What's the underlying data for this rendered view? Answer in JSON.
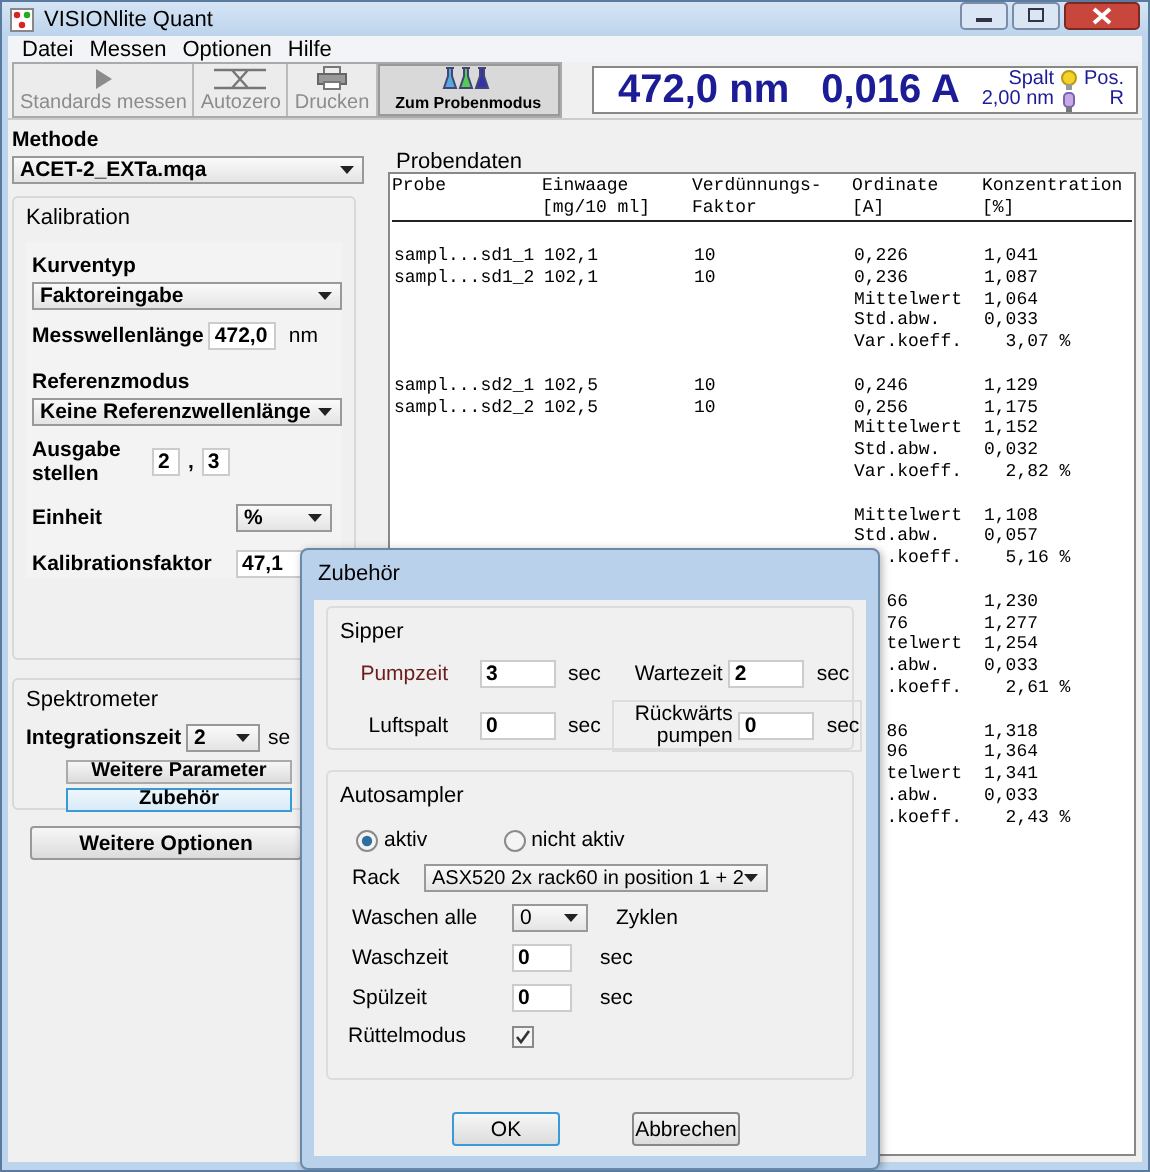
{
  "window": {
    "title": "VISIONlite Quant"
  },
  "menu": [
    "Datei",
    "Messen",
    "Optionen",
    "Hilfe"
  ],
  "toolbar": [
    {
      "label": "Standards messen",
      "disabled": true
    },
    {
      "label": "Autozero",
      "disabled": true
    },
    {
      "label": "Drucken",
      "disabled": true
    },
    {
      "label": "Zum Probenmodus",
      "disabled": false
    }
  ],
  "readout": {
    "wavelength": "472,0 nm",
    "absorbance": "0,016 A",
    "slit_label": "Spalt",
    "slit_value": "2,00 nm",
    "pos_label": "Pos.",
    "pos_value": "R"
  },
  "methode": {
    "label": "Methode",
    "value": "ACET-2_EXTa.mqa"
  },
  "kalibration": {
    "title": "Kalibration",
    "kurventyp_label": "Kurventyp",
    "kurventyp": "Faktoreingabe",
    "mess_label": "Messwellenlänge",
    "mess_value": "472,0",
    "mess_unit": "nm",
    "ref_label": "Referenzmodus",
    "ref_value": "Keine Referenzwellenlänge",
    "ausgabe_label": "Ausgabe stellen",
    "ausgabe_a": "2",
    "ausgabe_sep": ",",
    "ausgabe_b": "3",
    "einheit_label": "Einheit",
    "einheit": "%",
    "faktor_label": "Kalibrationsfaktor",
    "faktor": "47,1"
  },
  "spektrometer": {
    "title": "Spektrometer",
    "int_label": "Integrationszeit",
    "int_value": "2",
    "int_unit": "se",
    "buttons": [
      {
        "label": "Weitere Parameter",
        "focused": false
      },
      {
        "label": "Zubehör",
        "focused": true
      }
    ]
  },
  "weitere_optionen": "Weitere Optionen",
  "probendaten": {
    "title": "Probendaten",
    "columns": [
      {
        "line1": "Probe"
      },
      {
        "line1": "Einwaage",
        "line2": "[mg/10 ml]"
      },
      {
        "line1": "Verdünnungs-",
        "line2": "Faktor"
      },
      {
        "line1": "Ordinate",
        "line2": "[A]"
      },
      {
        "line1": "Konzentration",
        "line2": "[%]"
      }
    ],
    "groups": [
      {
        "rows": [
          {
            "kind": "full",
            "cells": [
              "sampl...sd1_1",
              "102,1",
              "10",
              "0,226",
              "1,041"
            ]
          },
          {
            "kind": "full",
            "cells": [
              "sampl...sd1_2",
              "102,1",
              "10",
              "0,236",
              "1,087"
            ]
          },
          {
            "kind": "full",
            "cells": [
              "",
              "",
              "",
              "Mittelwert",
              "1,064"
            ]
          },
          {
            "kind": "full",
            "cells": [
              "",
              "",
              "",
              "Std.abw.",
              "0,033"
            ]
          },
          {
            "kind": "full",
            "cells": [
              "",
              "",
              "",
              "Var.koeff.",
              "  3,07 %"
            ]
          }
        ]
      },
      {
        "rows": [
          {
            "kind": "full",
            "cells": [
              "sampl...sd2_1",
              "102,5",
              "10",
              "0,246",
              "1,129"
            ]
          },
          {
            "kind": "full",
            "cells": [
              "sampl...sd2_2",
              "102,5",
              "10",
              "0,256",
              "1,175"
            ]
          },
          {
            "kind": "full",
            "cells": [
              "",
              "",
              "",
              "Mittelwert",
              "1,152"
            ]
          },
          {
            "kind": "full",
            "cells": [
              "",
              "",
              "",
              "Std.abw.",
              "0,032"
            ]
          },
          {
            "kind": "full",
            "cells": [
              "",
              "",
              "",
              "Var.koeff.",
              "  2,82 %"
            ]
          }
        ]
      },
      {
        "rows": [
          {
            "kind": "full",
            "cells": [
              "",
              "",
              "",
              "Mittelwert",
              "1,108"
            ]
          },
          {
            "kind": "full",
            "cells": [
              "",
              "",
              "",
              "Std.abw.",
              "0,057"
            ]
          },
          {
            "kind": "partial",
            "cells": [
              "",
              "",
              "",
              ".koeff.",
              "  5,16 %"
            ]
          }
        ]
      },
      {
        "rows": [
          {
            "kind": "partial",
            "cells": [
              "",
              "",
              "",
              "66",
              "1,230"
            ]
          },
          {
            "kind": "partial",
            "cells": [
              "",
              "",
              "",
              "76",
              "1,277"
            ]
          },
          {
            "kind": "partial",
            "cells": [
              "",
              "",
              "",
              "telwert",
              "1,254"
            ]
          },
          {
            "kind": "partial",
            "cells": [
              "",
              "",
              "",
              ".abw.",
              "0,033"
            ]
          },
          {
            "kind": "partial",
            "cells": [
              "",
              "",
              "",
              ".koeff.",
              "  2,61 %"
            ]
          }
        ]
      },
      {
        "rows": [
          {
            "kind": "partial",
            "cells": [
              "",
              "",
              "",
              "86",
              "1,318"
            ]
          },
          {
            "kind": "partial",
            "cells": [
              "",
              "",
              "",
              "96",
              "1,364"
            ]
          },
          {
            "kind": "partial",
            "cells": [
              "",
              "",
              "",
              "telwert",
              "1,341"
            ]
          },
          {
            "kind": "partial",
            "cells": [
              "",
              "",
              "",
              ".abw.",
              "0,033"
            ]
          },
          {
            "kind": "partial",
            "cells": [
              "",
              "",
              "",
              ".koeff.",
              "  2,43 %"
            ]
          }
        ]
      }
    ]
  },
  "dialog": {
    "title": "Zubehör",
    "sipper": {
      "title": "Sipper",
      "fields": [
        {
          "kind": "plain",
          "label": "Pumpzeit",
          "value": "3",
          "unit": "sec",
          "color": "#6b1c1c"
        },
        {
          "kind": "plain",
          "label": "Wartezeit",
          "value": "2",
          "unit": "sec",
          "color": "#000000"
        },
        {
          "kind": "plain",
          "label": "Luftspalt",
          "value": "0",
          "unit": "sec",
          "color": "#000000"
        },
        {
          "kind": "boxed",
          "label": "Rückwärts pumpen",
          "value": "0",
          "unit": "sec",
          "color": "#000000"
        }
      ]
    },
    "autosampler": {
      "title": "Autosampler",
      "radios": [
        {
          "label": "aktiv",
          "selected": true
        },
        {
          "label": "nicht aktiv",
          "selected": false
        }
      ],
      "rack_label": "Rack",
      "rack_value": "ASX520 2x rack60 in position 1 + 2",
      "waschen_label": "Waschen alle",
      "waschen_value": "0",
      "waschen_unit": "Zyklen",
      "waschzeit_label": "Waschzeit",
      "waschzeit_value": "0",
      "waschzeit_unit": "sec",
      "spuelzeit_label": "Spülzeit",
      "spuelzeit_value": "0",
      "spuelzeit_unit": "sec",
      "ruettel_label": "Rüttelmodus",
      "ruettel_checked": true
    },
    "buttons": [
      {
        "label": "OK",
        "default": true
      },
      {
        "label": "Abbrechen",
        "default": false
      }
    ]
  }
}
